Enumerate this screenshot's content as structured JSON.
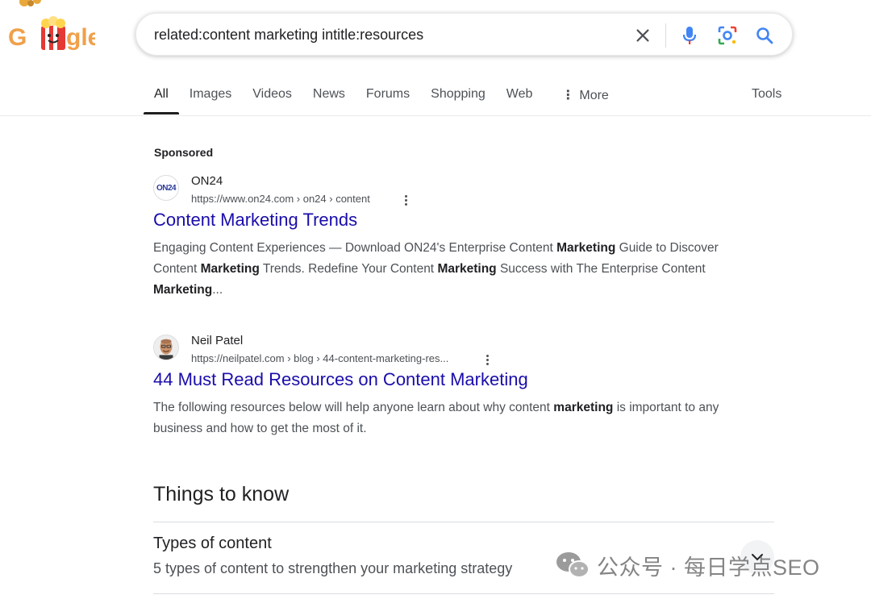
{
  "logo": {
    "text": "Google",
    "doodle": "popcorn-bucket"
  },
  "search": {
    "query": "related:content marketing intitle:resources",
    "placeholder": ""
  },
  "tabs": [
    {
      "label": "All",
      "active": true
    },
    {
      "label": "Images"
    },
    {
      "label": "Videos"
    },
    {
      "label": "News"
    },
    {
      "label": "Forums"
    },
    {
      "label": "Shopping"
    },
    {
      "label": "Web"
    },
    {
      "label": "More"
    }
  ],
  "tools_label": "Tools",
  "sponsored_label": "Sponsored",
  "results": [
    {
      "site_name": "ON24",
      "favicon_text": "ON24",
      "url": "https://www.on24.com › on24 › content",
      "title": "Content Marketing Trends",
      "snippet": [
        {
          "t": "Engaging Content Experiences — Download ON24's Enterprise Content "
        },
        {
          "t": "Marketing",
          "b": true
        },
        {
          "t": " Guide to Discover Content "
        },
        {
          "t": "Marketing",
          "b": true
        },
        {
          "t": " Trends. Redefine Your Content "
        },
        {
          "t": "Marketing",
          "b": true
        },
        {
          "t": " Success with The Enterprise Content "
        },
        {
          "t": "Marketing",
          "b": true
        },
        {
          "t": "..."
        }
      ]
    },
    {
      "site_name": "Neil Patel",
      "url": "https://neilpatel.com › blog › 44-content-marketing-res...",
      "title": "44 Must Read Resources on Content Marketing",
      "snippet": [
        {
          "t": "The following resources below will help anyone learn about why content "
        },
        {
          "t": "marketing",
          "b": true
        },
        {
          "t": " is important to any business and how to get the most of it."
        }
      ]
    }
  ],
  "things_to_know": {
    "title": "Things to know",
    "items": [
      {
        "title": "Types of content",
        "subtitle": "5 types of content to strengthen your marketing strategy"
      }
    ]
  },
  "watermark": {
    "text": "公众号 · 每日学点SEO"
  },
  "colors": {
    "link": "#1a0dab",
    "text": "#202124",
    "muted": "#4d5156",
    "mic_blue": "#4285f4",
    "mic_red": "#ea4335"
  }
}
